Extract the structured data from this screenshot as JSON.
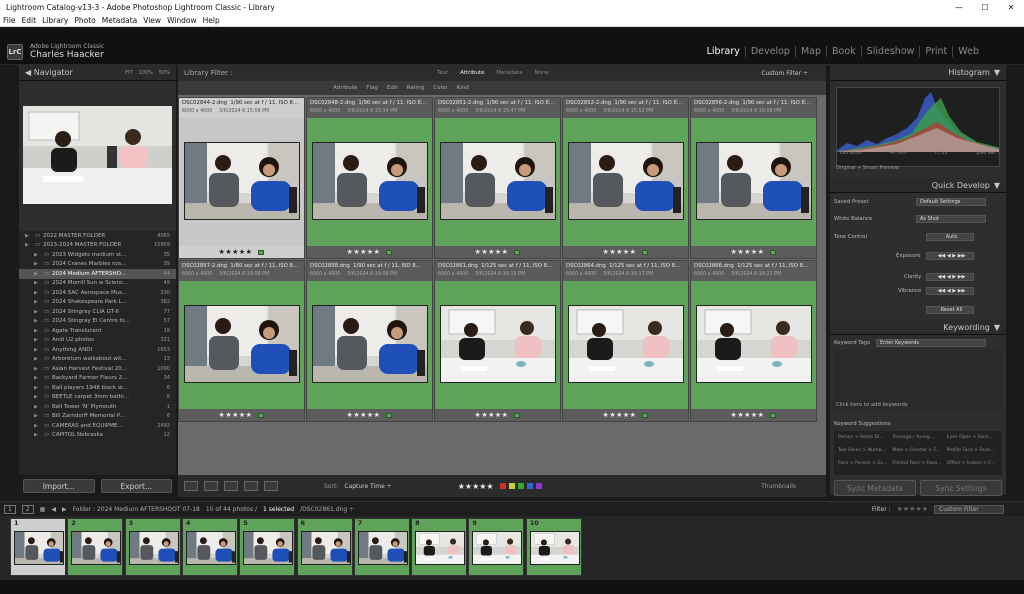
{
  "window": {
    "title": "Lightroom Catalog-v13-3 - Adobe Photoshop Lightroom Classic - Library",
    "minimize": "—",
    "maximize": "☐",
    "close": "✕"
  },
  "menu": [
    "File",
    "Edit",
    "Library",
    "Photo",
    "Metadata",
    "View",
    "Window",
    "Help"
  ],
  "identity": {
    "logo": "LrC",
    "product": "Adobe Lightroom Classic",
    "user": "Charles Haacker"
  },
  "modules": [
    "Library",
    "Develop",
    "Map",
    "Book",
    "Slideshow",
    "Print",
    "Web"
  ],
  "left": {
    "navigator": {
      "title": "Navigator",
      "zoom": [
        "FIT",
        "100%",
        "50%"
      ]
    },
    "folders": [
      {
        "name": "2022 MASTER FOLDER",
        "count": "4065",
        "top": true
      },
      {
        "name": "2023-2024 MASTER FOLDER",
        "count": "15959",
        "top": true
      },
      {
        "name": "2023 Widgets medium st...",
        "count": "35"
      },
      {
        "name": "2024 Cranes Marbles roa...",
        "count": "39"
      },
      {
        "name": "2024 Medium AFTERSHO...",
        "count": "44",
        "sel": true
      },
      {
        "name": "2024 Morrill Sun w Scienc...",
        "count": "49"
      },
      {
        "name": "2024 SAC Aerospace Mus...",
        "count": "230"
      },
      {
        "name": "2024 Shakespeare Park L...",
        "count": "362"
      },
      {
        "name": "2024 Stingray CLIA GT-II",
        "count": "77"
      },
      {
        "name": "2024 Stingray El Centro fo...",
        "count": "57"
      },
      {
        "name": "Agate Translucent",
        "count": "19"
      },
      {
        "name": "Andi U2 photos",
        "count": "321"
      },
      {
        "name": "Anything ANDI",
        "count": "1653"
      },
      {
        "name": "Arboretum walkabout wit...",
        "count": "13"
      },
      {
        "name": "Asian Harvest Festival 20...",
        "count": "1090"
      },
      {
        "name": "Backyard Farmer Fleurs 2...",
        "count": "34"
      },
      {
        "name": "Ball players 1948 black w...",
        "count": "6"
      },
      {
        "name": "BEETLE carpet 3mm bathi...",
        "count": "6"
      },
      {
        "name": "Bell Tower 'N' Plymouth",
        "count": "1"
      },
      {
        "name": "Bill Zarndorff Memorial P...",
        "count": "6"
      },
      {
        "name": "CAMERAS and EQUIPME...",
        "count": "2492"
      },
      {
        "name": "CAPITOL Nebraska",
        "count": "12"
      }
    ],
    "import": "Import...",
    "export": "Export..."
  },
  "filter": {
    "title": "Library Filter :",
    "tabs": [
      "Text",
      "Attribute",
      "Metadata",
      "None"
    ],
    "preset": "Custom Filter ÷"
  },
  "attrbar": [
    "Attribute",
    "Flag",
    "Edit",
    "Rating",
    "Color",
    "Kind"
  ],
  "grid": [
    {
      "name": "DSC02844-2.dng",
      "exp": "1/90 sec at f / 11, ISO 8...",
      "dims": "6000 x 4000",
      "date": "3/6/2024 6:15:08 PM",
      "sel": true,
      "scene": "pair"
    },
    {
      "name": "DSC02848-2.dng",
      "exp": "1/90 sec at f / 11, ISO 8...",
      "dims": "6000 x 4000",
      "date": "3/6/2024 6:15:34 PM",
      "scene": "pair"
    },
    {
      "name": "DSC02851-2.dng",
      "exp": "1/90 sec at f / 11, ISO 8...",
      "dims": "6000 x 4000",
      "date": "3/6/2024 6:15:47 PM",
      "scene": "pair"
    },
    {
      "name": "DSC02852-2.dng",
      "exp": "1/90 sec at f / 11, ISO 8...",
      "dims": "6000 x 4000",
      "date": "3/6/2024 6:15:52 PM",
      "scene": "pair"
    },
    {
      "name": "DSC02856-2.dng",
      "exp": "1/90 sec at f / 11, ISO 8...",
      "dims": "6000 x 4000",
      "date": "3/6/2024 6:16:08 PM",
      "scene": "pair"
    },
    {
      "name": "DSC02857-2.dng",
      "exp": "1/60 sec at f / 11, ISO 8...",
      "dims": "6000 x 4000",
      "date": "3/6/2024 6:16:09 PM",
      "scene": "pair"
    },
    {
      "name": "DSC02858.dng",
      "exp": "1/90 sec at f / 11, ISO 8...",
      "dims": "6000 x 4000",
      "date": "3/6/2024 6:16:09 PM",
      "scene": "pair"
    },
    {
      "name": "DSC02861.dng",
      "exp": "1/125 sec at f / 11, ISO 8...",
      "dims": "6000 x 4000",
      "date": "3/6/2024 6:16:15 PM",
      "scene": "table"
    },
    {
      "name": "DSC02864.dng",
      "exp": "1/125 sec at f / 11, ISO 8...",
      "dims": "6000 x 4000",
      "date": "3/6/2024 6:16:17 PM",
      "scene": "table"
    },
    {
      "name": "DSC02866.dng",
      "exp": "1/125 sec at f / 11, ISO 8...",
      "dims": "6000 x 4000",
      "date": "3/6/2024 6:16:22 PM",
      "scene": "table"
    }
  ],
  "rating_stars": "★★★★★",
  "toolbar": {
    "sort_label": "Sort:",
    "sort_value": "Capture Time ÷",
    "stars": "★★★★★",
    "thumbnails": "Thumbnails"
  },
  "right": {
    "histogram": "Histogram",
    "hist_info": [
      "ISO 8000",
      "47 mm",
      "f / 11",
      "1/90 sec"
    ],
    "smart": "Original + Smart Preview",
    "quick_develop": "Quick Develop",
    "saved_preset": "Saved Preset",
    "saved_preset_val": "Default Settings",
    "wb": "White Balance",
    "wb_val": "As Shot",
    "tone": "Tone Control",
    "tone_val": "Auto",
    "exposure": "Exposure",
    "clarity": "Clarity",
    "vibrance": "Vibrance",
    "reset": "Reset All",
    "keywording": "Keywording",
    "kw_tags": "Keyword Tags",
    "kw_tags_val": "Enter Keywords",
    "kw_click": "Click here to add keywords",
    "kw_sugg": "Keyword Suggestions",
    "suggestions": [
      "Person > Roots Dr...",
      "Teenage / Young ...",
      "Eyes Open > Face...",
      "Two Faces > Numb...",
      "Male > Gender > F...",
      "Profile Face > Face...",
      "Face > Person > Ex...",
      "Frontal Face > Face...",
      "Office > Indoor > F..."
    ],
    "sync_meta": "Sync Metadata",
    "sync_set": "Sync Settings"
  },
  "filmbar": {
    "page1": "1",
    "page2": "2",
    "path": "Folder : 2024 Medium AFTERSHOOT 07-18",
    "count": "10 of 44 photos /",
    "selected": "1 selected",
    "file": "/DSC02861.dng ÷",
    "filter": "Filter :",
    "stars": "★★★★★",
    "custom": "Custom Filter"
  },
  "filmstrip": [
    {
      "n": "1",
      "scene": "pair",
      "sel": true
    },
    {
      "n": "2",
      "scene": "pair"
    },
    {
      "n": "3",
      "scene": "pair"
    },
    {
      "n": "4",
      "scene": "pair"
    },
    {
      "n": "5",
      "scene": "pair"
    },
    {
      "n": "6",
      "scene": "pair"
    },
    {
      "n": "7",
      "scene": "pair"
    },
    {
      "n": "8",
      "scene": "table"
    },
    {
      "n": "9",
      "scene": "table"
    },
    {
      "n": "10",
      "scene": "table"
    }
  ]
}
